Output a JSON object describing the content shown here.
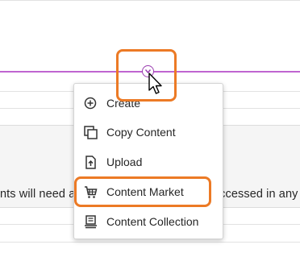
{
  "background": {
    "partial_text_left": "nts will need a",
    "partial_text_right": "accessed in any"
  },
  "add_content_button": {
    "icon": "add-circle-icon"
  },
  "menu": {
    "items": [
      {
        "label": "Create",
        "icon": "plus-circle-icon"
      },
      {
        "label": "Copy Content",
        "icon": "copy-icon"
      },
      {
        "label": "Upload",
        "icon": "upload-icon"
      },
      {
        "label": "Content Market",
        "icon": "cart-icon",
        "highlighted": true
      },
      {
        "label": "Content Collection",
        "icon": "collection-icon"
      }
    ]
  },
  "colors": {
    "accent_purple": "#bf65d0",
    "highlight_orange": "#ec7a25",
    "text": "#262626"
  }
}
